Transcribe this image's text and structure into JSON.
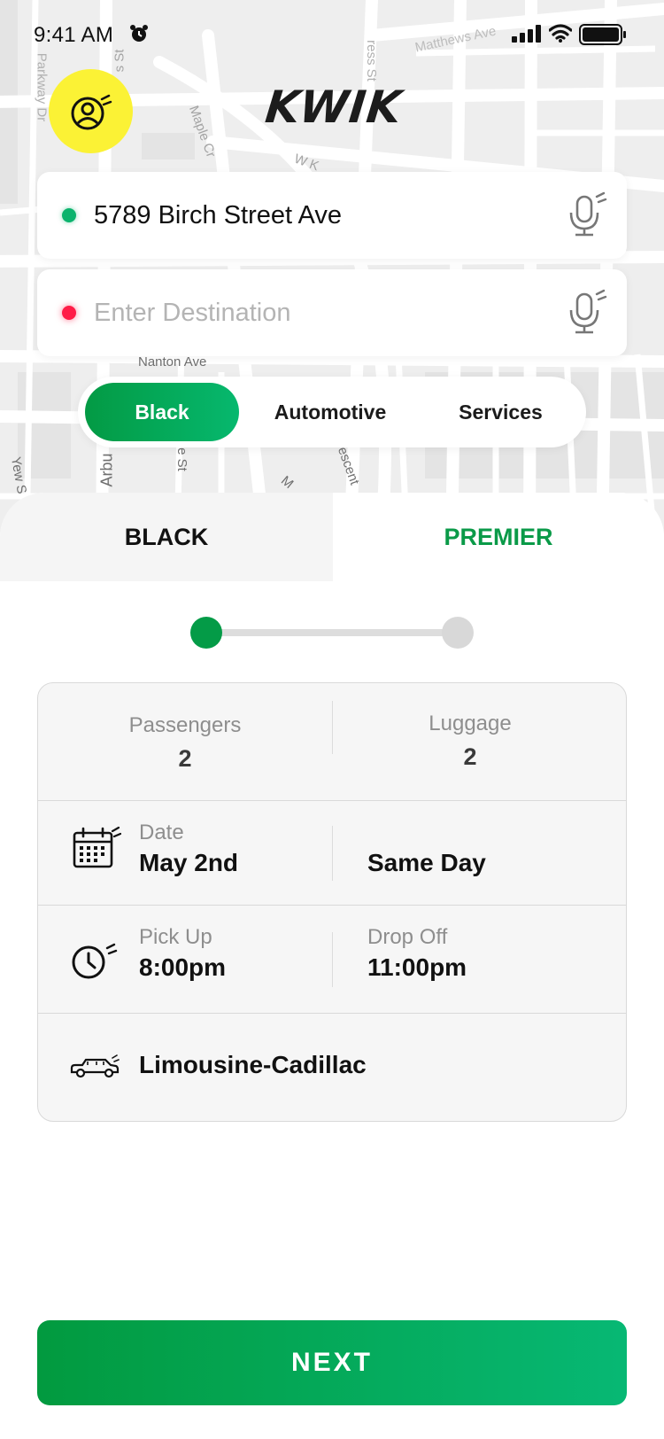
{
  "status_bar": {
    "time": "9:41 AM",
    "icons": [
      "alarm-icon",
      "signal-icon",
      "wifi-icon",
      "battery-icon"
    ]
  },
  "map": {
    "street_labels": [
      "Matthews Ave",
      "Parkway Dr",
      "Maple Cr",
      "W K",
      "Nanton Ave",
      "Arbu",
      "e St",
      "M",
      "rescent",
      "Yew S",
      "s St",
      "ress St"
    ]
  },
  "header": {
    "logo": "KWIK",
    "profile_icon": "profile-icon"
  },
  "pickup": {
    "value": "5789 Birch Street Ave",
    "placeholder": ""
  },
  "destination": {
    "value": "",
    "placeholder": "Enter Destination"
  },
  "categories": [
    {
      "label": "Black",
      "active": true
    },
    {
      "label": "Automotive",
      "active": false
    },
    {
      "label": "Services",
      "active": false
    }
  ],
  "class_tabs": [
    {
      "label": "BLACK",
      "active": false
    },
    {
      "label": "PREMIER",
      "active": true
    }
  ],
  "stepper": {
    "current": 1,
    "total": 2
  },
  "details": {
    "passengers_label": "Passengers",
    "passengers_value": "2",
    "luggage_label": "Luggage",
    "luggage_value": "2",
    "date_label": "Date",
    "date_value": "May 2nd",
    "date_option": "Same Day",
    "pickup_label": "Pick Up",
    "pickup_time": "8:00pm",
    "dropoff_label": "Drop Off",
    "dropoff_time": "11:00pm",
    "vehicle": "Limousine-Cadillac"
  },
  "next_label": "NEXT",
  "colors": {
    "accent_green": "#059e4a",
    "accent_green_light": "#07b874",
    "profile_yellow": "#fbf235",
    "pickup_dot": "#0bb36d",
    "destination_dot": "#ff1c47"
  }
}
